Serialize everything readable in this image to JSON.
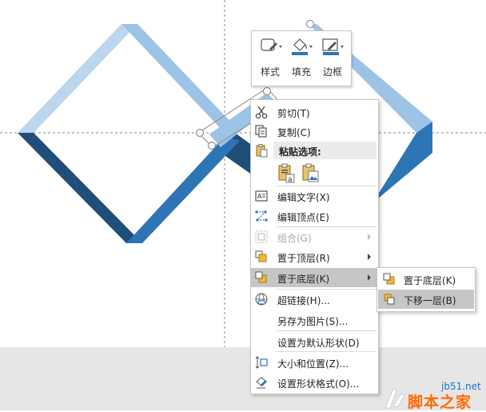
{
  "mini_toolbar": {
    "style_label": "样式",
    "fill_label": "填充",
    "border_label": "边框"
  },
  "context_menu": {
    "items": {
      "cut": "剪切(T)",
      "copy": "复制(C)",
      "paste_options": "粘贴选项:",
      "edit_text": "编辑文字(X)",
      "edit_points": "编辑顶点(E)",
      "group": "组合(G)",
      "bring_to_front": "置于顶层(R)",
      "send_to_back": "置于底层(K)",
      "hyperlink": "超链接(H)...",
      "save_as_picture": "另存为图片(S)...",
      "set_default_shape": "设置为默认形状(D)",
      "size_position": "大小和位置(Z)...",
      "format_shape": "设置形状格式(O)..."
    }
  },
  "submenu": {
    "send_to_back": "置于底层(K)",
    "send_backward": "下移一层(B)"
  },
  "watermark": {
    "url": "jb51.net",
    "brand": "脚本之家"
  },
  "colors": {
    "light_blue": "#bcd6ee",
    "mid_blue": "#9dc3e6",
    "blue": "#2e75b6",
    "dark_blue": "#1f4e79",
    "menu_hover": "#c6c6c6",
    "watermark_orange": "#ff6a00",
    "watermark_blue": "#1a73c9"
  }
}
